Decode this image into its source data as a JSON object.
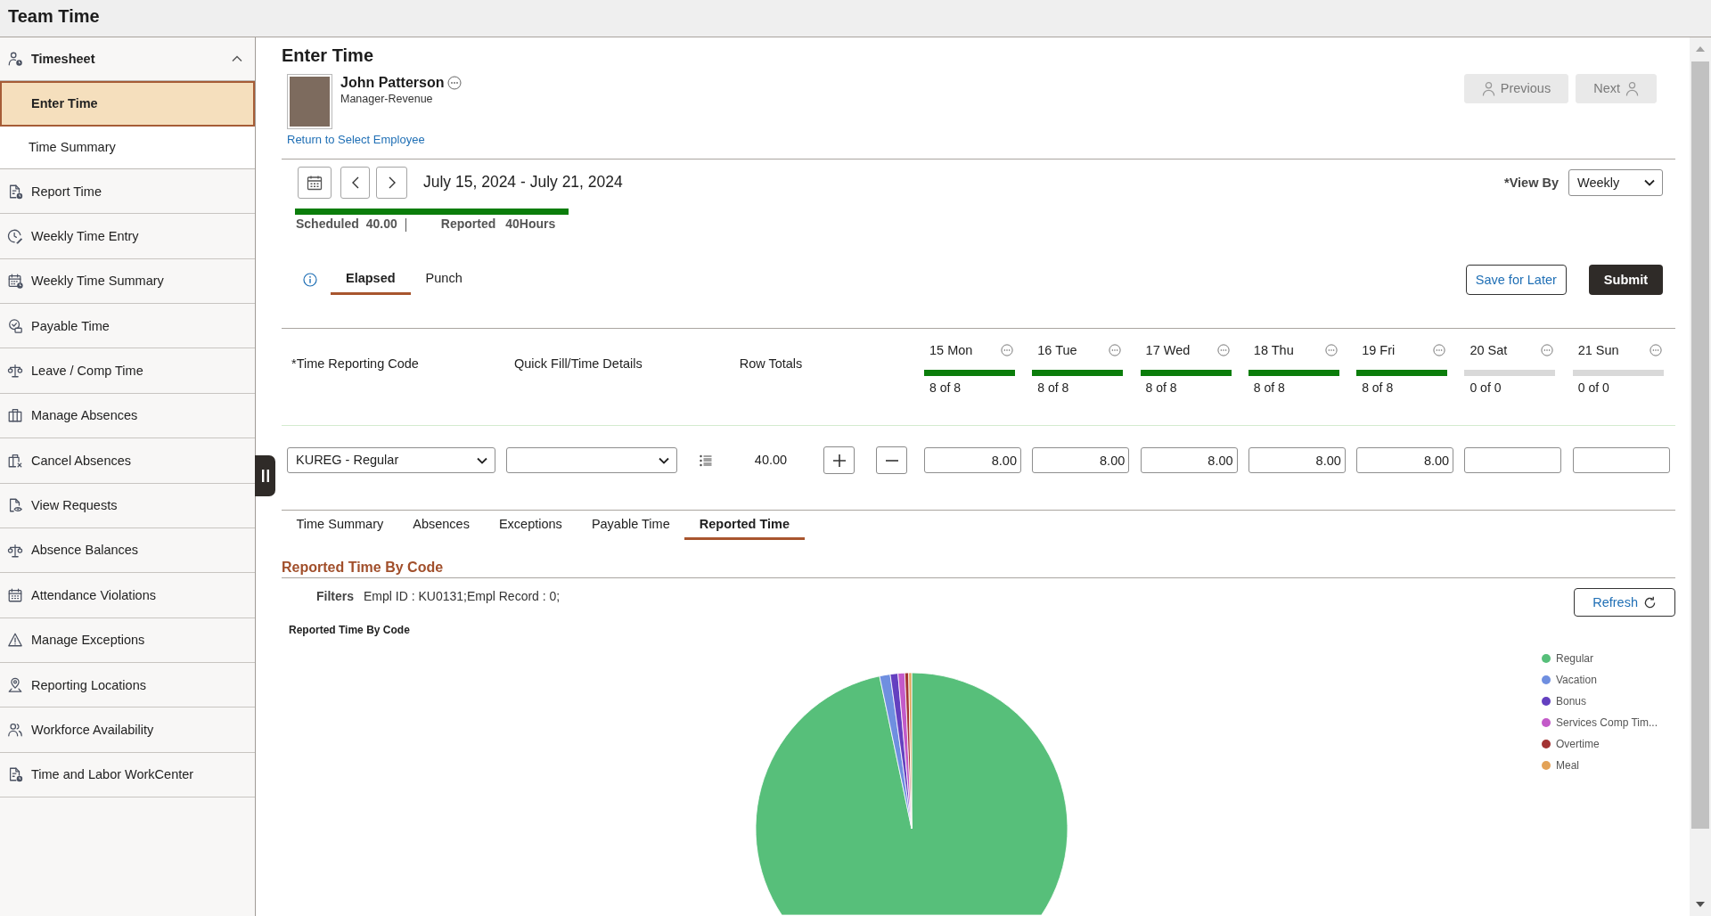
{
  "header": {
    "title": "Team Time"
  },
  "sidebar": {
    "section": {
      "label": "Timesheet",
      "expanded": true,
      "children": [
        {
          "label": "Enter Time",
          "selected": true
        },
        {
          "label": "Time Summary",
          "selected": false
        }
      ]
    },
    "items": [
      {
        "label": "Report Time"
      },
      {
        "label": "Weekly Time Entry"
      },
      {
        "label": "Weekly Time Summary"
      },
      {
        "label": "Payable Time"
      },
      {
        "label": "Leave / Comp Time"
      },
      {
        "label": "Manage Absences"
      },
      {
        "label": "Cancel Absences"
      },
      {
        "label": "View Requests"
      },
      {
        "label": "Absence Balances"
      },
      {
        "label": "Attendance Violations"
      },
      {
        "label": "Manage Exceptions"
      },
      {
        "label": "Reporting Locations"
      },
      {
        "label": "Workforce Availability"
      },
      {
        "label": "Time and Labor WorkCenter"
      }
    ]
  },
  "page": {
    "title": "Enter Time"
  },
  "employee": {
    "name": "John Patterson",
    "job_title": "Manager-Revenue",
    "return_link": "Return to Select Employee"
  },
  "employee_nav": [
    {
      "label": "Previous",
      "disabled": true
    },
    {
      "label": "Next",
      "disabled": true
    }
  ],
  "period": {
    "range": "July 15, 2024 - July 21, 2024",
    "level": 1,
    "scheduled_label": "Scheduled",
    "scheduled": "40.00",
    "reported_label": "Reported",
    "reported": "40Hours"
  },
  "view_by": {
    "label": "*View By",
    "value": "Weekly"
  },
  "entry_tabs": [
    {
      "label": "Elapsed",
      "selected": true
    },
    {
      "label": "Punch",
      "selected": false
    }
  ],
  "actions": [
    {
      "label": "Save for Later",
      "kind": "secondary"
    },
    {
      "label": "Submit",
      "kind": "primary"
    }
  ],
  "grid": {
    "columns": [
      "*Time Reporting Code",
      "Quick Fill/Time Details",
      "Row Totals"
    ],
    "days": [
      {
        "label": "15 Mon",
        "summary": "8 of 8",
        "level": 1
      },
      {
        "label": "16 Tue",
        "summary": "8 of 8",
        "level": 1
      },
      {
        "label": "17 Wed",
        "summary": "8 of 8",
        "level": 1
      },
      {
        "label": "18 Thu",
        "summary": "8 of 8",
        "level": 1
      },
      {
        "label": "19 Fri",
        "summary": "8 of 8",
        "level": 1
      },
      {
        "label": "20 Sat",
        "summary": "0 of 0",
        "level": 0
      },
      {
        "label": "21 Sun",
        "summary": "0 of 0",
        "level": 0
      }
    ],
    "rows": [
      {
        "code": "KUREG - Regular",
        "total": "40.00",
        "hours": [
          "8.00",
          "8.00",
          "8.00",
          "8.00",
          "8.00"
        ]
      }
    ]
  },
  "detail_tabs": [
    {
      "label": "Time Summary",
      "selected": false
    },
    {
      "label": "Absences",
      "selected": false
    },
    {
      "label": "Exceptions",
      "selected": false
    },
    {
      "label": "Payable Time",
      "selected": false
    },
    {
      "label": "Reported Time",
      "selected": true
    }
  ],
  "report": {
    "title": "Reported Time By Code",
    "filters_label": "Filters",
    "filters": "Empl ID : KU0131;Empl Record : 0;",
    "refresh": "Refresh",
    "chart": {
      "title": "Reported Time By Code",
      "legend": [
        {
          "label": "Regular",
          "color": "#57bf7a"
        },
        {
          "label": "Vacation",
          "color": "#6f8fe0"
        },
        {
          "label": "Bonus",
          "color": "#6440c0"
        },
        {
          "label": "Services Comp Tim...",
          "color": "#c35ac9"
        },
        {
          "label": "Overtime",
          "color": "#a33333"
        },
        {
          "label": "Meal",
          "color": "#e3a257"
        }
      ]
    }
  }
}
